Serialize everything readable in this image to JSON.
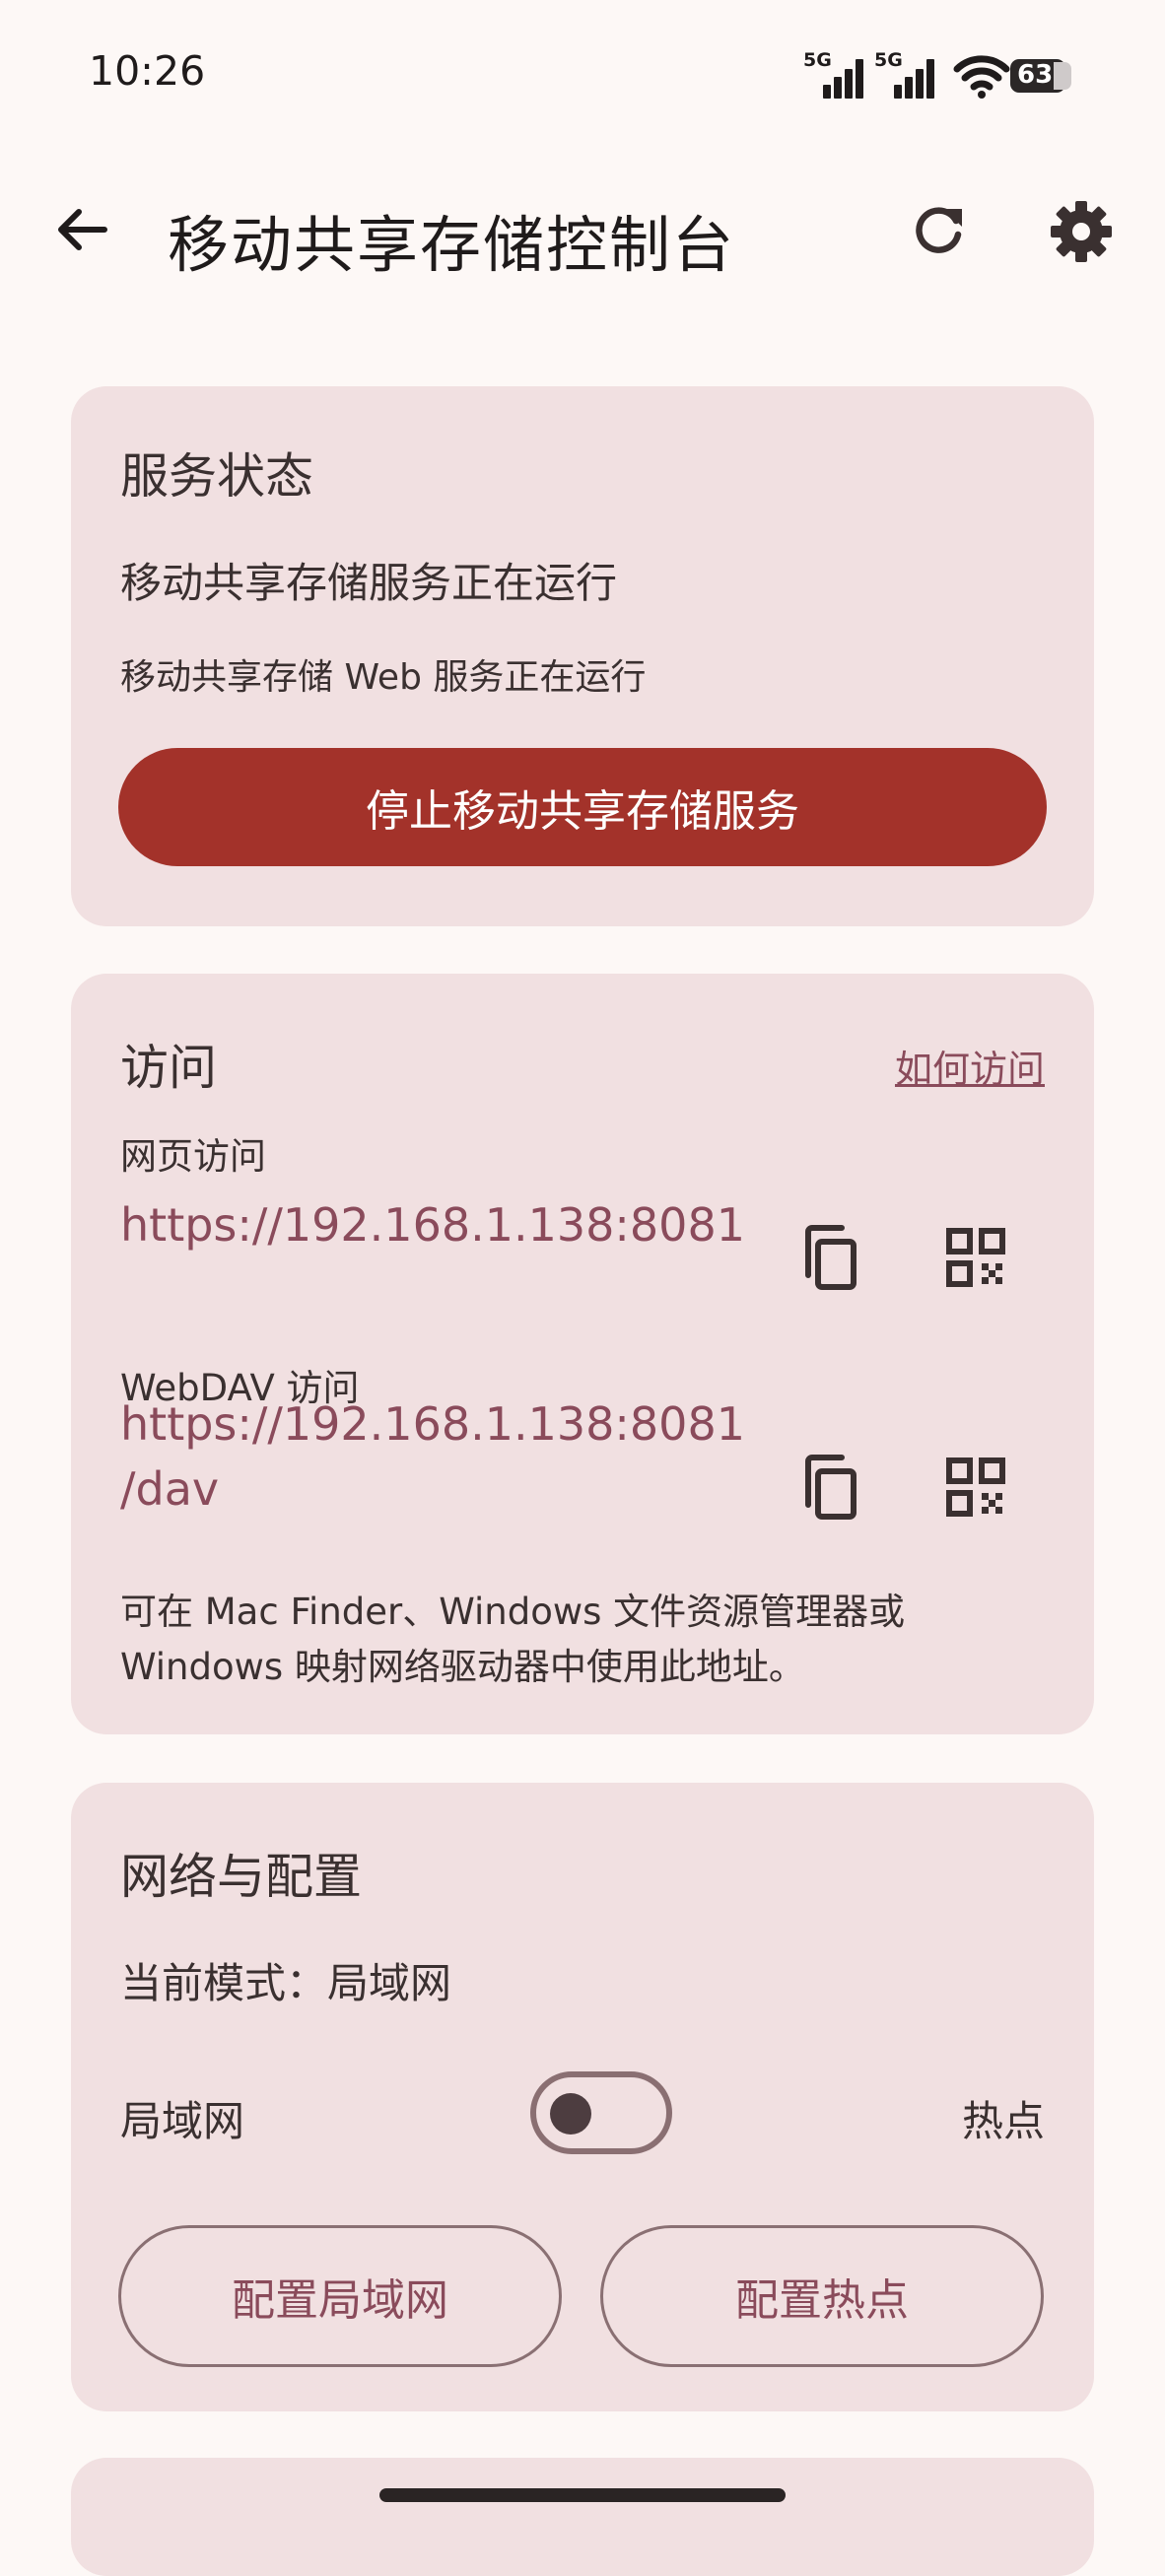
{
  "status_bar": {
    "time": "10:26",
    "signal1_label": "5G",
    "signal2_label": "5G",
    "battery": "63"
  },
  "app_bar": {
    "title": "移动共享存储控制台"
  },
  "service": {
    "heading": "服务状态",
    "status_main": "移动共享存储服务正在运行",
    "status_web": "移动共享存储 Web 服务正在运行",
    "stop_button": "停止移动共享存储服务"
  },
  "access": {
    "heading": "访问",
    "how_link": "如何访问",
    "web_label": "网页访问",
    "web_url": "https://192.168.1.138:8081",
    "webdav_label": "WebDAV 访问",
    "webdav_url_line1": "https://192.168.1.138:8081",
    "webdav_url_line2": "/dav",
    "hint_line1": "可在 Mac Finder、Windows 文件资源管理器或",
    "hint_line2": "Windows 映射网络驱动器中使用此地址。"
  },
  "network": {
    "heading": "网络与配置",
    "current_mode": "当前模式：局域网",
    "left_label": "局域网",
    "right_label": "热点",
    "lan_button": "配置局域网",
    "hotspot_button": "配置热点",
    "toggle_on": false
  },
  "colors": {
    "background": "#fdf8f6",
    "card": "#f1e0e1",
    "primary": "#a3322a",
    "link": "#8a4b5b"
  }
}
